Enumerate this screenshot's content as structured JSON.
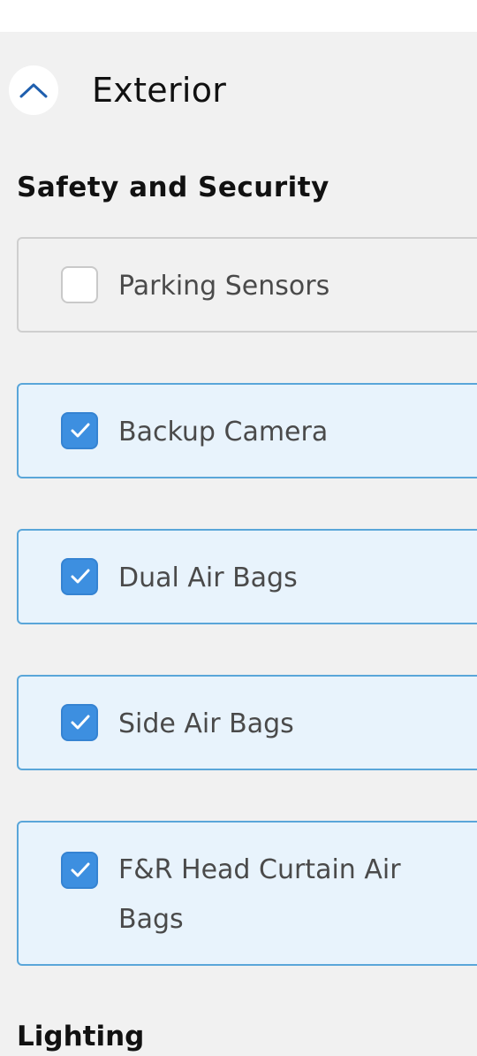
{
  "section": {
    "title": "Exterior",
    "collapse_icon": "chevron-up-icon"
  },
  "group": {
    "title": "Safety and Security"
  },
  "options": [
    {
      "label": "Parking Sensors",
      "checked": false
    },
    {
      "label": "Backup Camera",
      "checked": true
    },
    {
      "label": "Dual Air Bags",
      "checked": true
    },
    {
      "label": "Side Air Bags",
      "checked": true
    },
    {
      "label": "F&R Head Curtain Air Bags",
      "checked": true
    }
  ],
  "next_group": {
    "title": "Lighting"
  },
  "colors": {
    "accent": "#3d8fe0",
    "checked_card_bg": "#e8f3fc",
    "checked_card_border": "#5aa6d9",
    "unchecked_card_border": "#cfcfcf",
    "page_bg": "#f1f1f1"
  }
}
